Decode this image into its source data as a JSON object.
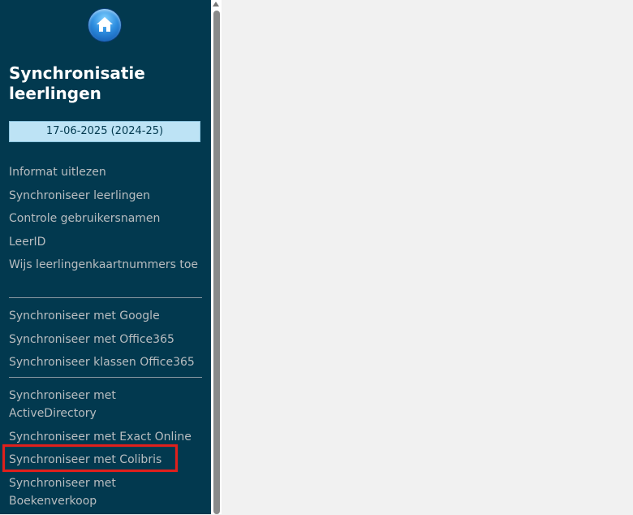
{
  "sidebar": {
    "title": "Synchronisatie leerlingen",
    "date": "17-06-2025 (2024-25)",
    "groups": [
      [
        {
          "label": "Informat uitlezen"
        },
        {
          "label": "Synchroniseer leerlingen"
        },
        {
          "label": "Controle gebruikersnamen"
        },
        {
          "label": "LeerID"
        },
        {
          "label": "Wijs leerlingenkaartnummers toe"
        }
      ],
      [
        {
          "label": "Synchroniseer met Google"
        },
        {
          "label": "Synchroniseer met Office365"
        },
        {
          "label": "Synchroniseer klassen Office365"
        }
      ],
      [
        {
          "label": "Synchroniseer met ActiveDirectory"
        },
        {
          "label": "Synchroniseer met Exact Online"
        },
        {
          "label": "Synchroniseer met Colibris"
        },
        {
          "label": "Synchroniseer met Boekenverkoop"
        }
      ]
    ]
  },
  "icons": {
    "home": "home-icon"
  },
  "colors": {
    "sidebar_bg": "#02394f",
    "highlight": "#e0201c",
    "date_bg": "#bde3f5"
  }
}
